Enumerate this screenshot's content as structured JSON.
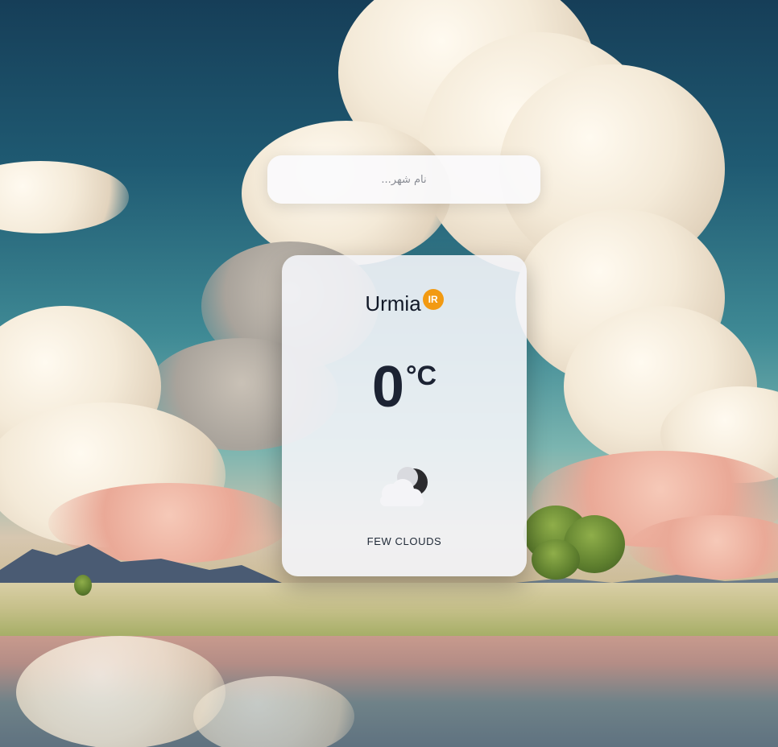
{
  "search": {
    "placeholder": "نام شهر..."
  },
  "weather": {
    "city": "Urmia",
    "country_code": "IR",
    "temperature": "0",
    "unit": "°C",
    "condition": "FEW CLOUDS",
    "icon": "few-clouds-night-icon"
  },
  "colors": {
    "badge": "#f29a12",
    "text_dark": "#1c2333",
    "card_bg": "#f3f4f8"
  }
}
